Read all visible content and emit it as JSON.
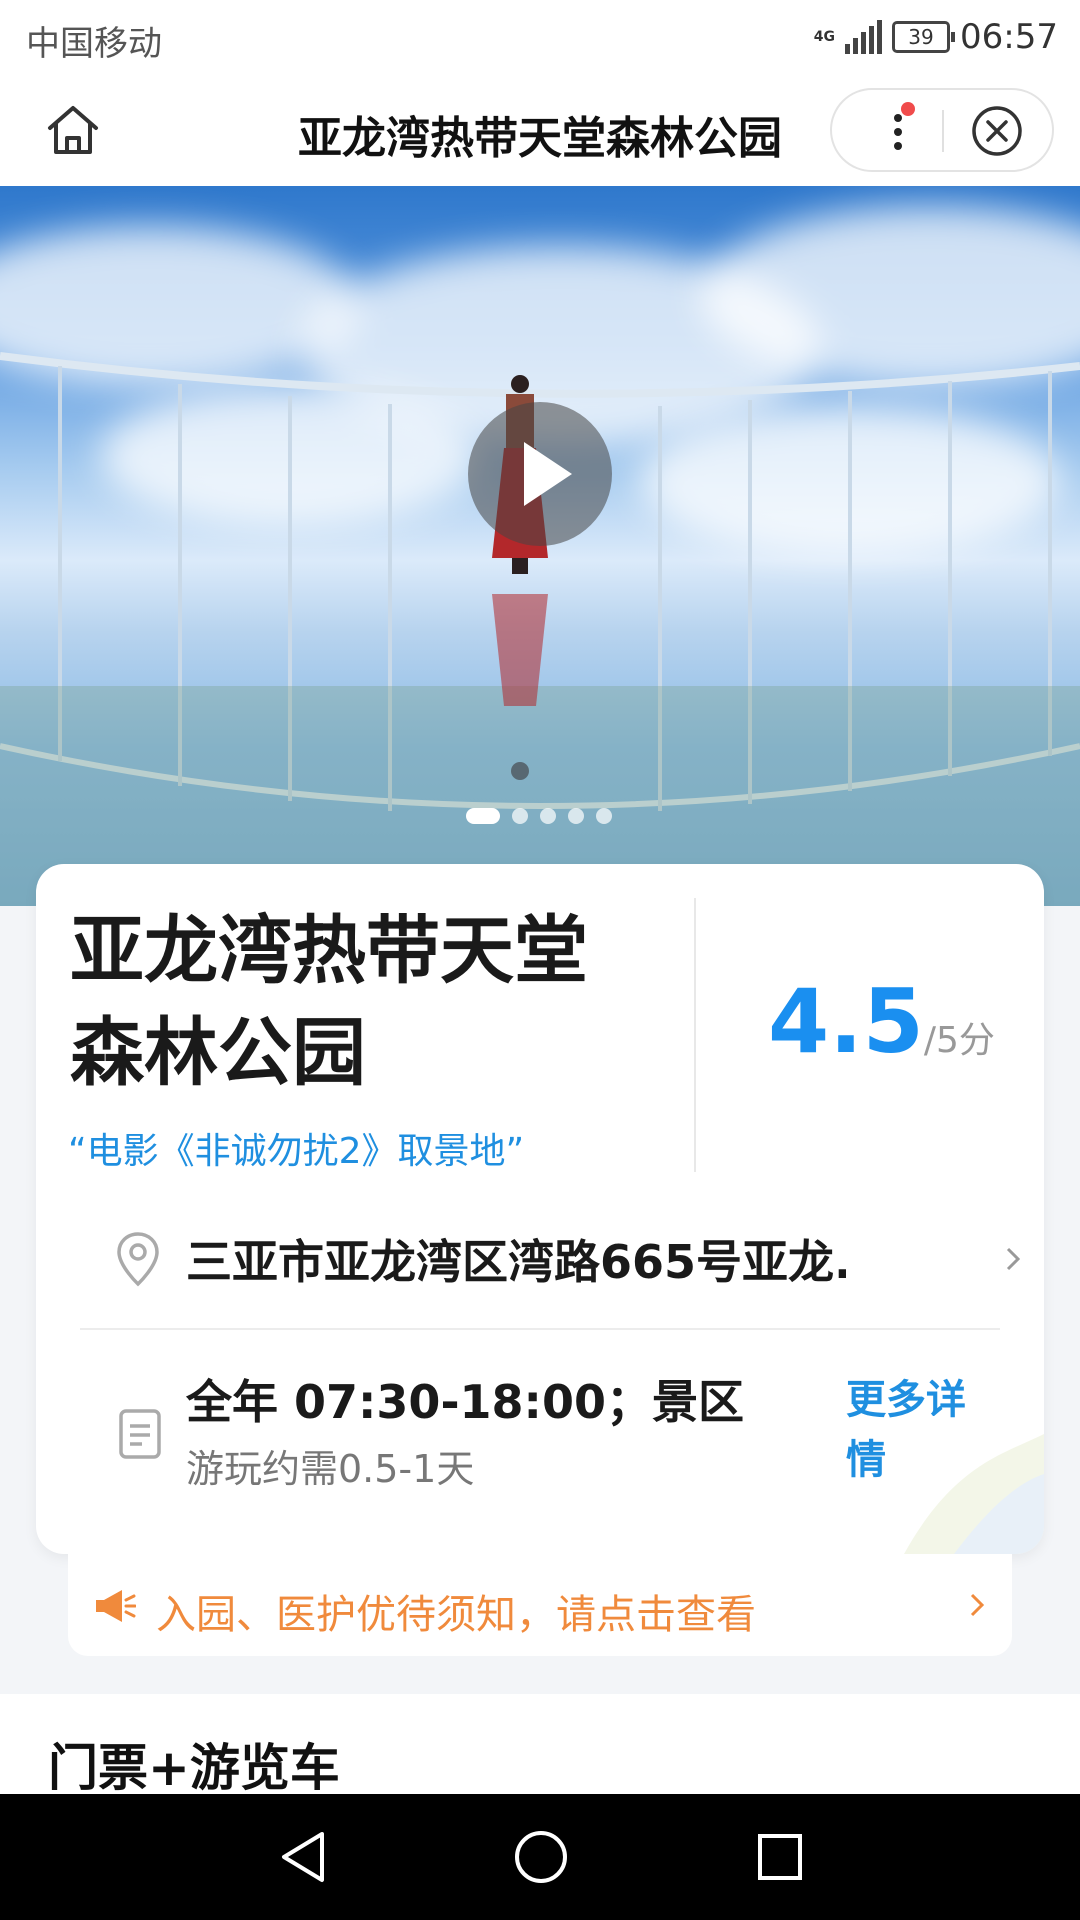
{
  "status_bar": {
    "carrier": "中国移动",
    "network": "4G",
    "battery": "39",
    "time": "06:57"
  },
  "nav": {
    "title": "亚龙湾热带天堂森林公园",
    "icons": [
      "home-icon",
      "more-icon",
      "close-icon"
    ]
  },
  "hero": {
    "slides_count": 5,
    "active_slide": 1,
    "media": "video"
  },
  "info": {
    "name": "亚龙湾热带天堂森林公园",
    "slogan": "“电影《非诚勿扰2》取景地”",
    "rating": "4.5",
    "rating_suffix": "/5分",
    "address": "三亚市亚龙湾区湾路665号亚龙...",
    "hours": "全年 07:30-18:00；景区...",
    "duration": "游玩约需0.5-1天",
    "more_detail": "更多详情"
  },
  "notice": {
    "text": "入园、医护优待须知，请点击查看"
  },
  "section": {
    "title": "门票+游览车"
  },
  "colors": {
    "accent": "#1a8ff0",
    "notice": "#f08a3c",
    "red_dot": "#f04b4b"
  }
}
